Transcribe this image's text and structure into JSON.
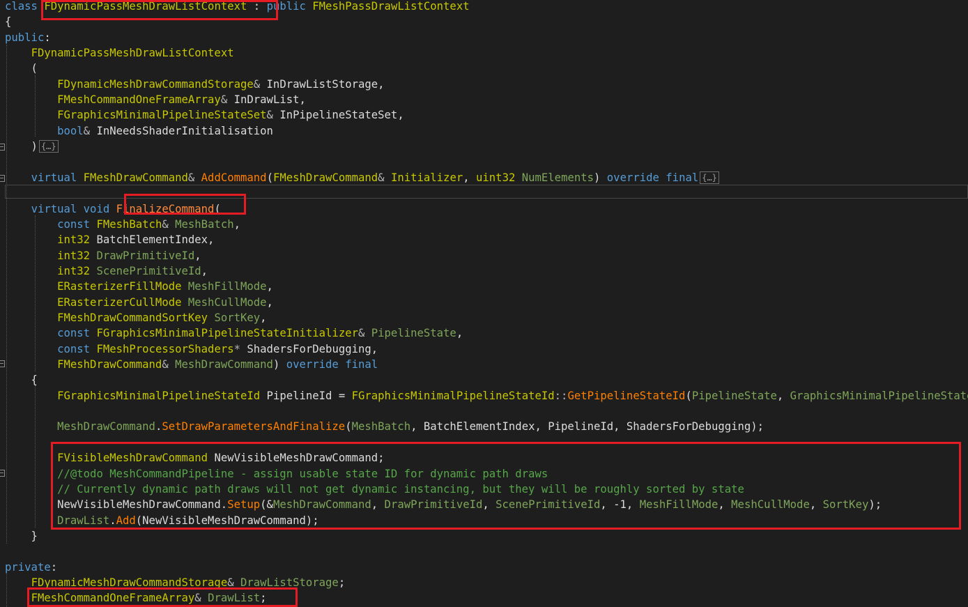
{
  "editor": {
    "theme": {
      "background": "#1e1e1e",
      "keyword": "#569cd6",
      "type": "#c8c800",
      "function": "#ff8000",
      "parameter": "#7fa65a",
      "comment": "#57a64a",
      "text": "#dcdcdc",
      "highlight_box": "#e51c23"
    },
    "collapsed_marker": "{…}",
    "lines": [
      [
        [
          "kw",
          "class "
        ],
        [
          "ty",
          "FDynamicPassMeshDrawListContext"
        ],
        [
          "tx",
          " : "
        ],
        [
          "kw",
          "public "
        ],
        [
          "ty",
          "FMeshPassDrawListContext"
        ]
      ],
      [
        [
          "tx",
          "{"
        ]
      ],
      [
        [
          "kw",
          "public"
        ],
        [
          "tx",
          ":"
        ]
      ],
      [
        [
          "tx",
          "    "
        ],
        [
          "ty",
          "FDynamicPassMeshDrawListContext"
        ]
      ],
      [
        [
          "tx",
          "    ("
        ]
      ],
      [
        [
          "tx",
          "        "
        ],
        [
          "ty",
          "FDynamicMeshDrawCommandStorage"
        ],
        [
          "op",
          "& "
        ],
        [
          "tx",
          "InDrawListStorage,"
        ]
      ],
      [
        [
          "tx",
          "        "
        ],
        [
          "ty",
          "FMeshCommandOneFrameArray"
        ],
        [
          "op",
          "& "
        ],
        [
          "tx",
          "InDrawList,"
        ]
      ],
      [
        [
          "tx",
          "        "
        ],
        [
          "ty",
          "FGraphicsMinimalPipelineStateSet"
        ],
        [
          "op",
          "& "
        ],
        [
          "tx",
          "InPipelineStateSet,"
        ]
      ],
      [
        [
          "tx",
          "        "
        ],
        [
          "kw",
          "bool"
        ],
        [
          "op",
          "& "
        ],
        [
          "tx",
          "InNeedsShaderInitialisation"
        ]
      ],
      [
        [
          "tx",
          "    )"
        ],
        [
          "cl",
          ""
        ]
      ],
      [],
      [
        [
          "tx",
          "    "
        ],
        [
          "kw",
          "virtual "
        ],
        [
          "ty",
          "FMeshDrawCommand"
        ],
        [
          "op",
          "& "
        ],
        [
          "fn",
          "AddCommand"
        ],
        [
          "tx",
          "("
        ],
        [
          "ty",
          "FMeshDrawCommand"
        ],
        [
          "op",
          "& "
        ],
        [
          "ty",
          "Initializer"
        ],
        [
          "tx",
          ", "
        ],
        [
          "ty",
          "uint32 "
        ],
        [
          "pm",
          "NumElements"
        ],
        [
          "tx",
          ") "
        ],
        [
          "kw",
          "override final"
        ],
        [
          "cl",
          ""
        ]
      ],
      [],
      [
        [
          "tx",
          "    "
        ],
        [
          "kw",
          "virtual void "
        ],
        [
          "hl",
          "FinalizeCommand"
        ],
        [
          "tx",
          "("
        ]
      ],
      [
        [
          "tx",
          "        "
        ],
        [
          "kw",
          "const "
        ],
        [
          "ty",
          "FMeshBatch"
        ],
        [
          "op",
          "& "
        ],
        [
          "pm",
          "MeshBatch"
        ],
        [
          "tx",
          ","
        ]
      ],
      [
        [
          "tx",
          "        "
        ],
        [
          "ty",
          "int32 "
        ],
        [
          "tx",
          "BatchElementIndex,"
        ]
      ],
      [
        [
          "tx",
          "        "
        ],
        [
          "ty",
          "int32 "
        ],
        [
          "pm",
          "DrawPrimitiveId"
        ],
        [
          "tx",
          ","
        ]
      ],
      [
        [
          "tx",
          "        "
        ],
        [
          "ty",
          "int32 "
        ],
        [
          "pm",
          "ScenePrimitiveId"
        ],
        [
          "tx",
          ","
        ]
      ],
      [
        [
          "tx",
          "        "
        ],
        [
          "ty",
          "ERasterizerFillMode "
        ],
        [
          "pm",
          "MeshFillMode"
        ],
        [
          "tx",
          ","
        ]
      ],
      [
        [
          "tx",
          "        "
        ],
        [
          "ty",
          "ERasterizerCullMode "
        ],
        [
          "pm",
          "MeshCullMode"
        ],
        [
          "tx",
          ","
        ]
      ],
      [
        [
          "tx",
          "        "
        ],
        [
          "ty",
          "FMeshDrawCommandSortKey "
        ],
        [
          "pm",
          "SortKey"
        ],
        [
          "tx",
          ","
        ]
      ],
      [
        [
          "tx",
          "        "
        ],
        [
          "kw",
          "const "
        ],
        [
          "ty",
          "FGraphicsMinimalPipelineStateInitializer"
        ],
        [
          "op",
          "& "
        ],
        [
          "pm",
          "PipelineState"
        ],
        [
          "tx",
          ","
        ]
      ],
      [
        [
          "tx",
          "        "
        ],
        [
          "kw",
          "const "
        ],
        [
          "ty",
          "FMeshProcessorShaders"
        ],
        [
          "op",
          "* "
        ],
        [
          "tx",
          "ShadersForDebugging,"
        ]
      ],
      [
        [
          "tx",
          "        "
        ],
        [
          "ty",
          "FMeshDrawCommand"
        ],
        [
          "op",
          "& "
        ],
        [
          "pm",
          "MeshDrawCommand"
        ],
        [
          "tx",
          ") "
        ],
        [
          "kw",
          "override final"
        ]
      ],
      [
        [
          "tx",
          "    {"
        ]
      ],
      [
        [
          "tx",
          "        "
        ],
        [
          "ty",
          "FGraphicsMinimalPipelineStateId "
        ],
        [
          "tx",
          "PipelineId = "
        ],
        [
          "ty",
          "FGraphicsMinimalPipelineStateId"
        ],
        [
          "op",
          "::"
        ],
        [
          "fn",
          "GetPipelineStateId"
        ],
        [
          "tx",
          "("
        ],
        [
          "pm",
          "PipelineState"
        ],
        [
          "tx",
          ", "
        ],
        [
          "pm",
          "GraphicsMinimalPipelineStateSet"
        ],
        [
          "tx",
          ");"
        ]
      ],
      [],
      [
        [
          "tx",
          "        "
        ],
        [
          "pm",
          "MeshDrawCommand"
        ],
        [
          "tx",
          "."
        ],
        [
          "fn",
          "SetDrawParametersAndFinalize"
        ],
        [
          "tx",
          "("
        ],
        [
          "pm",
          "MeshBatch"
        ],
        [
          "tx",
          ", BatchElementIndex, PipelineId, ShadersForDebugging);"
        ]
      ],
      [],
      [
        [
          "tx",
          "        "
        ],
        [
          "ty",
          "FVisibleMeshDrawCommand "
        ],
        [
          "tx",
          "NewVisibleMeshDrawCommand;"
        ]
      ],
      [
        [
          "tx",
          "        "
        ],
        [
          "cm",
          "//@todo MeshCommandPipeline - assign usable state ID for dynamic path draws"
        ]
      ],
      [
        [
          "tx",
          "        "
        ],
        [
          "cm",
          "// Currently dynamic path draws will not get dynamic instancing, but they will be roughly sorted by state"
        ]
      ],
      [
        [
          "tx",
          "        NewVisibleMeshDrawCommand."
        ],
        [
          "fn",
          "Setup"
        ],
        [
          "tx",
          "(&"
        ],
        [
          "pm",
          "MeshDrawCommand"
        ],
        [
          "tx",
          ", "
        ],
        [
          "pm",
          "DrawPrimitiveId"
        ],
        [
          "tx",
          ", "
        ],
        [
          "pm",
          "ScenePrimitiveId"
        ],
        [
          "tx",
          ", -1, "
        ],
        [
          "pm",
          "MeshFillMode"
        ],
        [
          "tx",
          ", "
        ],
        [
          "pm",
          "MeshCullMode"
        ],
        [
          "tx",
          ", "
        ],
        [
          "pm",
          "SortKey"
        ],
        [
          "tx",
          ");"
        ]
      ],
      [
        [
          "tx",
          "        "
        ],
        [
          "pm",
          "DrawList"
        ],
        [
          "tx",
          "."
        ],
        [
          "fn",
          "Add"
        ],
        [
          "tx",
          "(NewVisibleMeshDrawCommand);"
        ]
      ],
      [
        [
          "tx",
          "    }"
        ]
      ],
      [],
      [
        [
          "kw",
          "private"
        ],
        [
          "tx",
          ":"
        ]
      ],
      [
        [
          "tx",
          "    "
        ],
        [
          "ty",
          "FDynamicMeshDrawCommandStorage"
        ],
        [
          "op",
          "& "
        ],
        [
          "pm",
          "DrawListStorage"
        ],
        [
          "tx",
          ";"
        ]
      ],
      [
        [
          "tx",
          "    "
        ],
        [
          "ty",
          "FMeshCommandOneFrameArray"
        ],
        [
          "op",
          "& "
        ],
        [
          "pm",
          "DrawList"
        ],
        [
          "tx",
          ";"
        ]
      ]
    ]
  }
}
